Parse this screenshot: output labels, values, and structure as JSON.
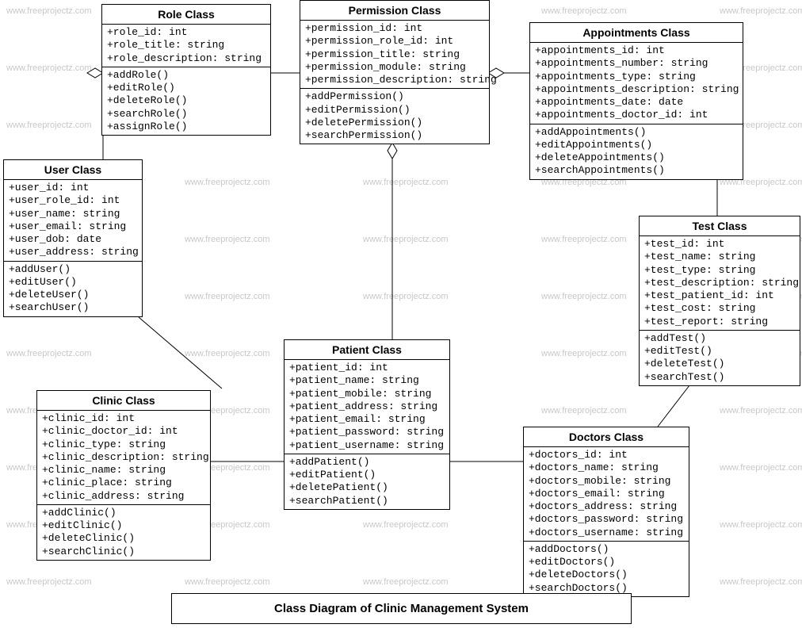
{
  "title": "Class Diagram of Clinic Management System",
  "watermark": "www.freeprojectz.com",
  "classes": {
    "role": {
      "name": "Role Class",
      "attrs": [
        "+role_id: int",
        "+role_title: string",
        "+role_description: string"
      ],
      "methods": [
        "+addRole()",
        "+editRole()",
        "+deleteRole()",
        "+searchRole()",
        "+assignRole()"
      ]
    },
    "permission": {
      "name": "Permission Class",
      "attrs": [
        "+permission_id: int",
        "+permission_role_id: int",
        "+permission_title: string",
        "+permission_module: string",
        "+permission_description: string"
      ],
      "methods": [
        "+addPermission()",
        "+editPermission()",
        "+deletePermission()",
        "+searchPermission()"
      ]
    },
    "appointments": {
      "name": "Appointments Class",
      "attrs": [
        "+appointments_id: int",
        "+appointments_number: string",
        "+appointments_type: string",
        "+appointments_description: string",
        "+appointments_date: date",
        "+appointments_doctor_id: int"
      ],
      "methods": [
        "+addAppointments()",
        "+editAppointments()",
        "+deleteAppointments()",
        "+searchAppointments()"
      ]
    },
    "user": {
      "name": "User Class",
      "attrs": [
        "+user_id: int",
        "+user_role_id: int",
        "+user_name: string",
        "+user_email: string",
        "+user_dob: date",
        "+user_address: string"
      ],
      "methods": [
        "+addUser()",
        "+editUser()",
        "+deleteUser()",
        "+searchUser()"
      ]
    },
    "test": {
      "name": "Test Class",
      "attrs": [
        "+test_id: int",
        "+test_name: string",
        "+test_type: string",
        "+test_description: string",
        "+test_patient_id: int",
        "+test_cost: string",
        "+test_report: string"
      ],
      "methods": [
        "+addTest()",
        "+editTest()",
        "+deleteTest()",
        "+searchTest()"
      ]
    },
    "patient": {
      "name": "Patient Class",
      "attrs": [
        "+patient_id: int",
        "+patient_name: string",
        "+patient_mobile: string",
        "+patient_address: string",
        "+patient_email: string",
        "+patient_password: string",
        "+patient_username: string"
      ],
      "methods": [
        "+addPatient()",
        "+editPatient()",
        "+deletePatient()",
        "+searchPatient()"
      ]
    },
    "clinic": {
      "name": "Clinic Class",
      "attrs": [
        "+clinic_id: int",
        "+clinic_doctor_id: int",
        "+clinic_type: string",
        "+clinic_description: string",
        "+clinic_name: string",
        "+clinic_place: string",
        "+clinic_address: string"
      ],
      "methods": [
        "+addClinic()",
        "+editClinic()",
        "+deleteClinic()",
        "+searchClinic()"
      ]
    },
    "doctors": {
      "name": "Doctors Class",
      "attrs": [
        "+doctors_id: int",
        "+doctors_name: string",
        "+doctors_mobile: string",
        "+doctors_email: string",
        "+doctors_address: string",
        "+doctors_password: string",
        "+doctors_username: string"
      ],
      "methods": [
        "+addDoctors()",
        "+editDoctors()",
        "+deleteDoctors()",
        "+searchDoctors()"
      ]
    }
  }
}
